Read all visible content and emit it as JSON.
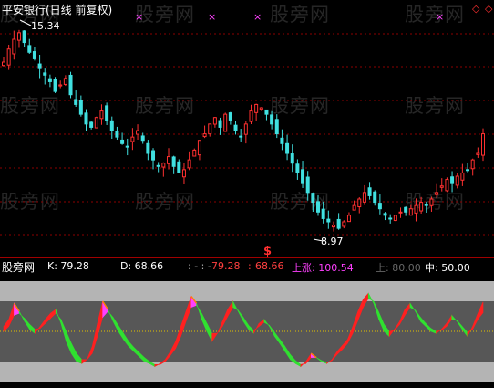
{
  "main_panel": {
    "title": "平安银行(日线 前复权)",
    "high_label": "15.34",
    "low_label": "8.97",
    "markers": [
      "×",
      "×",
      "×",
      "×",
      "◇",
      "◇"
    ],
    "signal_glyph": "$",
    "grid_color": "#8b0000",
    "bull_color": "#ff3030",
    "bear_color": "#40e0e0"
  },
  "indicator_panel": {
    "name": "股旁网",
    "k_label": "K: 79.28",
    "d_label": "D: 68.66",
    "dots_label": ": - : -",
    "v1": "79.28",
    "sep": ":",
    "v2": "68.66",
    "up_label": "上涨: 100.54",
    "top_label": "上: 80.00",
    "mid_label": "中: 50.00"
  },
  "watermark_text": "股旁网",
  "chart_data": [
    {
      "type": "candlestick",
      "title": "平安银行(日线 前复权)",
      "annotations": [
        {
          "label": "15.34",
          "kind": "high"
        },
        {
          "label": "8.97",
          "kind": "low"
        }
      ],
      "close": [
        14.2,
        14.6,
        14.9,
        15.1,
        14.8,
        14.5,
        14.3,
        14.0,
        13.8,
        13.6,
        13.3,
        13.5,
        13.7,
        13.2,
        12.9,
        12.6,
        12.3,
        12.2,
        12.5,
        12.7,
        12.4,
        12.1,
        11.9,
        11.7,
        11.6,
        11.9,
        12.1,
        11.8,
        11.4,
        11.2,
        11.0,
        11.1,
        11.3,
        11.0,
        10.8,
        10.9,
        11.2,
        11.5,
        11.8,
        12.0,
        12.3,
        12.5,
        12.2,
        12.6,
        12.4,
        12.1,
        11.9,
        12.3,
        12.7,
        12.9,
        12.8,
        12.6,
        12.3,
        12.0,
        11.7,
        11.4,
        11.1,
        10.8,
        10.5,
        10.2,
        9.9,
        9.6,
        9.4,
        9.3,
        9.2,
        9.1,
        9.3,
        9.5,
        9.8,
        10.0,
        10.2,
        10.1,
        9.9,
        9.7,
        9.5,
        9.4,
        9.5,
        9.6,
        9.6,
        9.7,
        9.8,
        9.9,
        9.8,
        10.0,
        10.2,
        10.4,
        10.6,
        10.5,
        10.7,
        10.8,
        10.9,
        11.2,
        11.4,
        12.0
      ]
    },
    {
      "type": "area",
      "title": "",
      "series_names": [
        "K",
        "D"
      ],
      "ylim": [
        0,
        100
      ],
      "reference_lines": [
        80,
        50
      ],
      "k": [
        55,
        62,
        78,
        70,
        60,
        52,
        48,
        55,
        62,
        68,
        72,
        58,
        40,
        28,
        20,
        18,
        22,
        35,
        58,
        80,
        72,
        60,
        50,
        42,
        35,
        30,
        25,
        20,
        18,
        15,
        18,
        22,
        30,
        40,
        55,
        70,
        85,
        78,
        62,
        50,
        40,
        48,
        60,
        72,
        80,
        70,
        60,
        52,
        48,
        58,
        62,
        55,
        45,
        38,
        30,
        22,
        18,
        15,
        20,
        28,
        24,
        20,
        18,
        22,
        30,
        36,
        42,
        55,
        70,
        82,
        88,
        78,
        62,
        50,
        45,
        52,
        60,
        72,
        78,
        70,
        60,
        55,
        50,
        48,
        52,
        58,
        66,
        60,
        52,
        45,
        55,
        68,
        79.28
      ],
      "d": [
        50,
        55,
        66,
        68,
        63,
        57,
        52,
        53,
        58,
        63,
        68,
        62,
        50,
        38,
        28,
        22,
        22,
        28,
        45,
        64,
        70,
        64,
        56,
        48,
        40,
        34,
        29,
        24,
        20,
        17,
        17,
        20,
        26,
        33,
        45,
        60,
        74,
        76,
        68,
        58,
        48,
        48,
        55,
        65,
        74,
        71,
        64,
        56,
        51,
        55,
        59,
        56,
        49,
        42,
        35,
        27,
        21,
        17,
        18,
        24,
        24,
        21,
        19,
        21,
        27,
        32,
        38,
        48,
        61,
        74,
        83,
        80,
        69,
        57,
        50,
        51,
        57,
        66,
        74,
        71,
        64,
        58,
        53,
        50,
        51,
        55,
        62,
        61,
        55,
        49,
        52,
        62,
        68.66
      ]
    }
  ]
}
